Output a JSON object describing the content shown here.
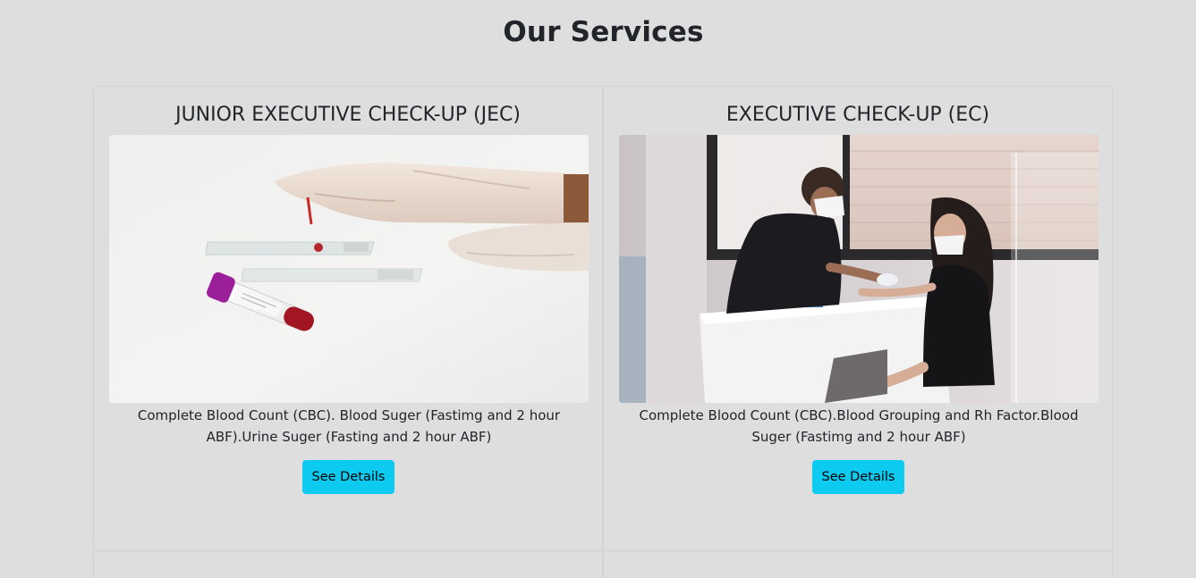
{
  "page": {
    "title": "Our Services"
  },
  "services": [
    {
      "title": "JUNIOR EXECUTIVE CHECK-UP (JEC)",
      "image": "blood-test-tube-and-slides-photo",
      "description": "Complete Blood Count (CBC). Blood Suger (Fastimg and 2 hour ABF).Urine Suger (Fasting and 2 hour ABF)",
      "button_label": "See Details"
    },
    {
      "title": "EXECUTIVE CHECK-UP (EC)",
      "image": "nurse-drawing-blood-from-patient-photo",
      "description": "Complete Blood Count (CBC).Blood Grouping and Rh Factor.Blood Suger (Fastimg and 2 hour ABF)",
      "button_label": "See Details"
    }
  ],
  "colors": {
    "background": "#dedede",
    "button": "#0dcaf0",
    "text": "#212529"
  }
}
